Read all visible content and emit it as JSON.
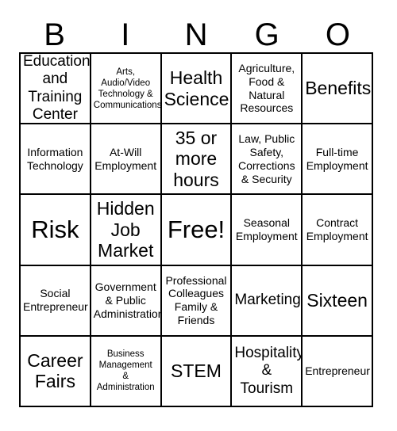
{
  "card": {
    "headers": [
      "B",
      "I",
      "N",
      "G",
      "O"
    ],
    "cells": [
      {
        "text": "Education\nand\nTraining\nCenter",
        "size": "md"
      },
      {
        "text": "Arts,\nAudio/Video\nTechnology &\nCommunications",
        "size": "xs"
      },
      {
        "text": "Health\nScience",
        "size": "lg"
      },
      {
        "text": "Agriculture,\nFood &\nNatural\nResources",
        "size": "sm"
      },
      {
        "text": "Benefits",
        "size": "lg"
      },
      {
        "text": "Information\nTechnology",
        "size": "sm"
      },
      {
        "text": "At-Will\nEmployment",
        "size": "sm"
      },
      {
        "text": "35 or\nmore\nhours",
        "size": "lg"
      },
      {
        "text": "Law, Public\nSafety,\nCorrections\n& Security",
        "size": "sm"
      },
      {
        "text": "Full-time\nEmployment",
        "size": "sm"
      },
      {
        "text": "Risk",
        "size": "xl"
      },
      {
        "text": "Hidden\nJob\nMarket",
        "size": "lg"
      },
      {
        "text": "Free!",
        "size": "xl"
      },
      {
        "text": "Seasonal\nEmployment",
        "size": "sm"
      },
      {
        "text": "Contract\nEmployment",
        "size": "sm"
      },
      {
        "text": "Social\nEntrepreneur",
        "size": "sm"
      },
      {
        "text": "Government\n& Public\nAdministration",
        "size": "sm"
      },
      {
        "text": "Professional\nColleagues\nFamily &\nFriends",
        "size": "sm"
      },
      {
        "text": "Marketing",
        "size": "md"
      },
      {
        "text": "Sixteen",
        "size": "lg"
      },
      {
        "text": "Career\nFairs",
        "size": "lg"
      },
      {
        "text": "Business\nManagement\n&\nAdministration",
        "size": "xs"
      },
      {
        "text": "STEM",
        "size": "lg"
      },
      {
        "text": "Hospitality\n& Tourism",
        "size": "md"
      },
      {
        "text": "Entrepreneur",
        "size": "sm"
      }
    ]
  }
}
